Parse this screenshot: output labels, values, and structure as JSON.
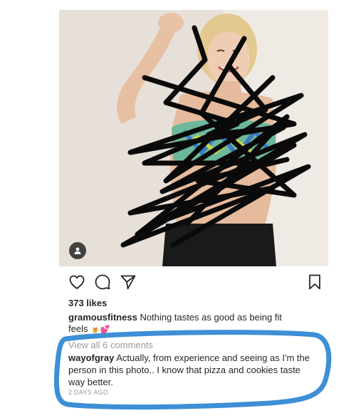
{
  "post": {
    "likes_text": "373 likes",
    "caption_user": "gramousfitness",
    "caption_text": "Nothing tastes as good as being fit feels",
    "caption_emojis": "🍺💕",
    "view_comments": "View all 6 comments",
    "comment_user": "wayofgray",
    "comment_text": "Actually, from experience and seeing as I'm the person in this photo.. I know that pizza and cookies taste way better.",
    "timestamp": "2 DAYS AGO"
  },
  "icons": {
    "like": "heart-icon",
    "comment": "comment-icon",
    "share": "share-icon",
    "save": "bookmark-icon",
    "tag": "user-tag-icon"
  },
  "colors": {
    "highlight_stroke": "#3d8fd6",
    "scribble": "#0a0a0a",
    "muted_text": "#999999"
  }
}
